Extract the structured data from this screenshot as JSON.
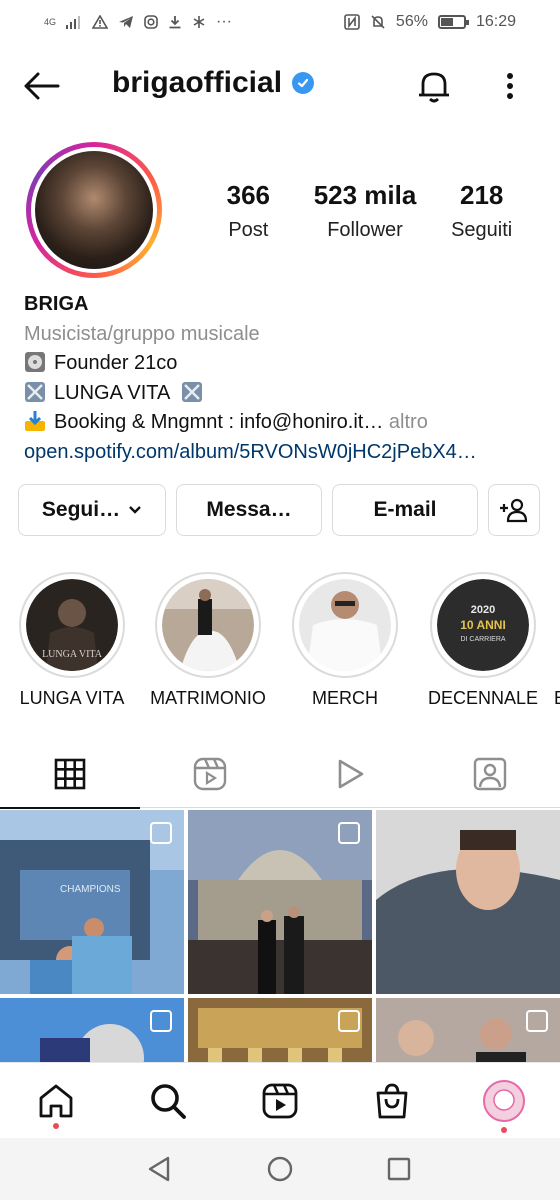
{
  "status_bar": {
    "network": "4G",
    "battery_percent": "56%",
    "battery_level": 0.56,
    "time": "16:29",
    "more": "···"
  },
  "header": {
    "username": "brigaofficial",
    "verified": true
  },
  "profile": {
    "stats": [
      {
        "value": "366",
        "label": "Post"
      },
      {
        "value": "523 mila",
        "label": "Follower"
      },
      {
        "value": "218",
        "label": "Seguiti"
      }
    ],
    "name": "BRIGA",
    "category": "Musicista/gruppo musicale",
    "bio_lines": [
      {
        "icon": "cd-icon",
        "text": "Founder 21co"
      },
      {
        "icon": "crossed-swords-icon",
        "text": "LUNGA VITA"
      },
      {
        "icon": "download-arrow-icon",
        "text": "Booking & Mngmnt : info@honiro.it…",
        "more": "altro"
      }
    ],
    "link": "open.spotify.com/album/5RVONsW0jHC2jPebX4…"
  },
  "actions": {
    "follow": "Segui…",
    "message": "Messa…",
    "email": "E-mail"
  },
  "highlights": [
    {
      "label": "LUNGA VITA",
      "cover_text": "LUNGA VITA"
    },
    {
      "label": "MATRIMONIO"
    },
    {
      "label": "MERCH"
    },
    {
      "label": "DECENNALE",
      "cover_lines": [
        "2020",
        "10 ANNI",
        "DI CARRIERA"
      ]
    },
    {
      "label": "B"
    }
  ],
  "tabs": [
    "grid-icon",
    "reels-icon",
    "video-icon",
    "tagged-icon"
  ],
  "grid_posts": [
    {
      "overlay_text": "CHAMPIONS",
      "multi": true
    },
    {
      "multi": true
    },
    {
      "multi": false
    },
    {
      "multi": true
    },
    {
      "multi": true
    },
    {
      "multi": true
    }
  ],
  "bottom_nav": [
    "home-icon",
    "search-icon",
    "reels-icon",
    "shop-icon",
    "profile-avatar"
  ],
  "colors": {
    "link": "#00376b",
    "secondary_text": "#8e8e8e",
    "verified": "#3897f0",
    "notification_dot": "#ed4956"
  }
}
